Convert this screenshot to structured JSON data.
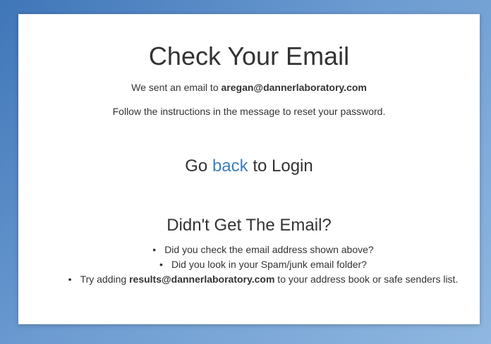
{
  "card": {
    "title": "Check Your Email",
    "sent_prefix": "We sent an email to ",
    "sent_email": "aregan@dannerlaboratory.com",
    "instructions": "Follow the instructions in the message to reset your password.",
    "goback_prefix": "Go ",
    "goback_link": "back",
    "goback_suffix": " to Login",
    "help_title": "Didn't Get The Email?",
    "tip1": "Did you check the email address shown above?",
    "tip2": "Did you look in your Spam/junk email folder?",
    "tip3_prefix": "Try adding ",
    "tip3_email": "results@dannerlaboratory.com",
    "tip3_suffix": " to your address book or safe senders list."
  },
  "colors": {
    "link": "#3c7fc0",
    "background_start": "#3f76b8",
    "background_end": "#8fb7e0"
  }
}
